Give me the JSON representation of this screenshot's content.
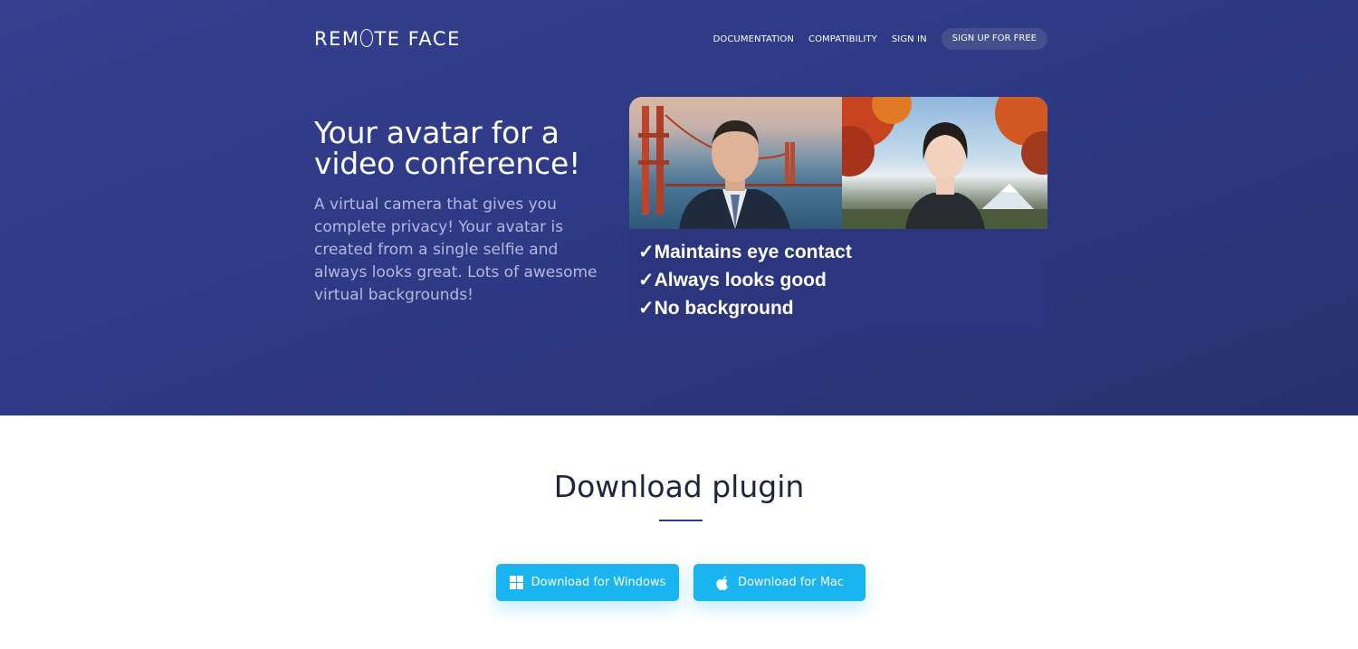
{
  "brand": {
    "logo_text_before": "REM",
    "logo_text_after": "TE FACE"
  },
  "nav": {
    "links": [
      "DOCUMENTATION",
      "COMPATIBILITY",
      "SIGN IN"
    ],
    "signup_label": "SIGN UP FOR FREE"
  },
  "hero": {
    "headline": "Your avatar for a video conference!",
    "subtext": "A virtual camera that gives you complete privacy! Your avatar is created from a single selfie and always looks great. Lots of awesome virtual backgrounds!",
    "benefits": [
      "✓Maintains eye contact",
      "✓Always looks good",
      "✓No background"
    ]
  },
  "download": {
    "title": "Download plugin",
    "windows_label": "Download for Windows",
    "mac_label": "Download for Mac"
  },
  "colors": {
    "hero_bg": "#2e3a85",
    "card_bg": "#2b367f",
    "button_bg": "#1ab5f0",
    "title_text": "#1e2540"
  },
  "icons": [
    "windows-icon",
    "apple-icon"
  ]
}
